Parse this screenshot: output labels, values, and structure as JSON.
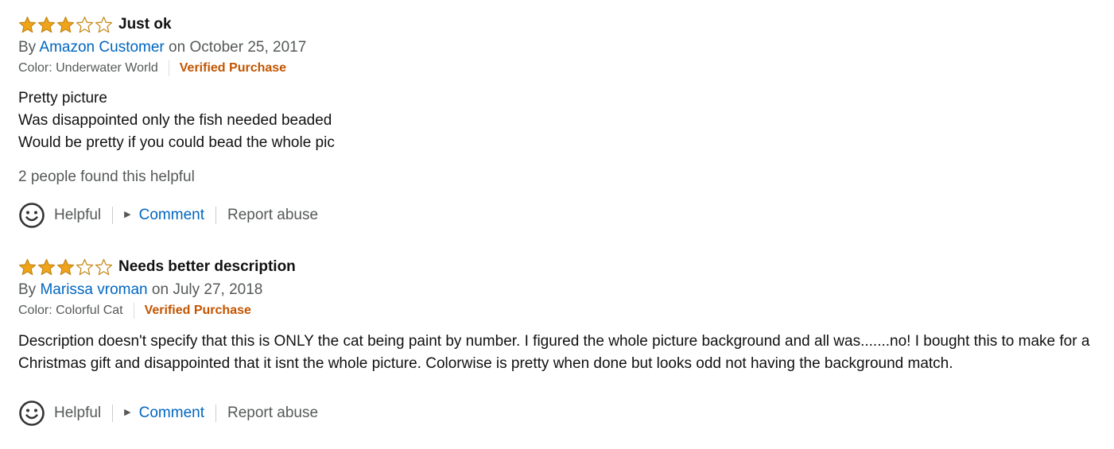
{
  "colors": {
    "star_fill": "#f0a41b",
    "star_stroke": "#c3850f",
    "link": "#0066c0",
    "verified": "#c45500",
    "secondary_text": "#565959"
  },
  "icons": {
    "star_full": "star-filled-icon",
    "star_empty": "star-empty-icon",
    "helpful": "smiley-face-icon",
    "comment_caret": "caret-right-icon"
  },
  "reviews": [
    {
      "rating": 3,
      "max_rating": 5,
      "title": "Just ok",
      "by_prefix": "By",
      "author": "Amazon Customer",
      "date_text": "on October 25, 2017",
      "variant": "Color: Underwater World",
      "verified": "Verified Purchase",
      "body": "Pretty picture\nWas disappointed only the fish needed beaded\nWould be pretty if you could bead the whole pic",
      "helpful_count": "2 people found this helpful",
      "actions": {
        "helpful": "Helpful",
        "comment": "Comment",
        "report": "Report abuse"
      }
    },
    {
      "rating": 3,
      "max_rating": 5,
      "title": "Needs better description",
      "by_prefix": "By",
      "author": "Marissa vroman",
      "date_text": "on July 27, 2018",
      "variant": "Color: Colorful Cat",
      "verified": "Verified Purchase",
      "body": "Description doesn't specify that this is ONLY the cat being paint by number. I figured the whole picture background and all was.......no! I bought this to make for a Christmas gift and disappointed that it isnt the whole picture. Colorwise is pretty when done but looks odd not having the background match.",
      "helpful_count": "",
      "actions": {
        "helpful": "Helpful",
        "comment": "Comment",
        "report": "Report abuse"
      }
    }
  ]
}
